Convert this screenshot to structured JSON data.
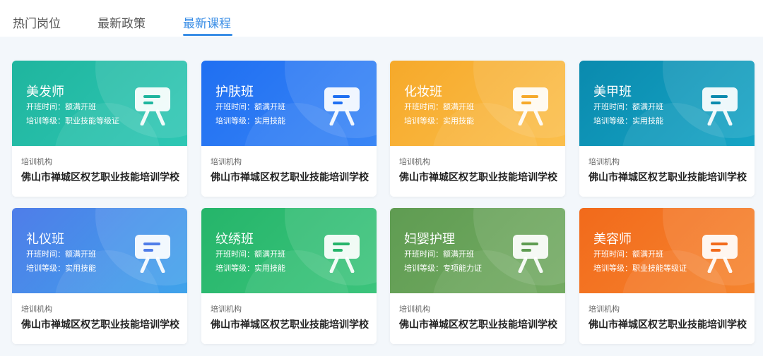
{
  "tabs": [
    {
      "label": "热门岗位",
      "active": false
    },
    {
      "label": "最新政策",
      "active": false
    },
    {
      "label": "最新课程",
      "active": true
    }
  ],
  "accent_color": "#3a8ee6",
  "courses": [
    {
      "title": "美发师",
      "start_label": "开班时间：",
      "start_value": "额满开班",
      "level_label": "培训等级：",
      "level_value": "职业技能等级证",
      "org_label": "培训机构",
      "org_name": "佛山市禅城区权艺职业技能培训学校",
      "gradient": [
        "#1fb59e",
        "#2ec7b4"
      ]
    },
    {
      "title": "护肤班",
      "start_label": "开班时间：",
      "start_value": "额满开班",
      "level_label": "培训等级：",
      "level_value": "实用技能",
      "org_label": "培训机构",
      "org_name": "佛山市禅城区权艺职业技能培训学校",
      "gradient": [
        "#1f6ff2",
        "#3a86f5"
      ]
    },
    {
      "title": "化妆班",
      "start_label": "开班时间：",
      "start_value": "额满开班",
      "level_label": "培训等级：",
      "level_value": "实用技能",
      "org_label": "培训机构",
      "org_name": "佛山市禅城区权艺职业技能培训学校",
      "gradient": [
        "#f6a92a",
        "#fbbf4c"
      ]
    },
    {
      "title": "美甲班",
      "start_label": "开班时间：",
      "start_value": "额满开班",
      "level_label": "培训等级：",
      "level_value": "实用技能",
      "org_label": "培训机构",
      "org_name": "佛山市禅城区权艺职业技能培训学校",
      "gradient": [
        "#0a8aae",
        "#16a5c5"
      ]
    },
    {
      "title": "礼仪班",
      "start_label": "开班时间：",
      "start_value": "额满开班",
      "level_label": "培训等级：",
      "level_value": "实用技能",
      "org_label": "培训机构",
      "org_name": "佛山市禅城区权艺职业技能培训学校",
      "gradient": [
        "#4f7de9",
        "#3fa3ea"
      ]
    },
    {
      "title": "纹绣班",
      "start_label": "开班时间：",
      "start_value": "额满开班",
      "level_label": "培训等级：",
      "level_value": "实用技能",
      "org_label": "培训机构",
      "org_name": "佛山市禅城区权艺职业技能培训学校",
      "gradient": [
        "#25b56a",
        "#3cc47c"
      ]
    },
    {
      "title": "妇婴护理",
      "start_label": "开班时间：",
      "start_value": "额满开班",
      "level_label": "培训等级：",
      "level_value": "专项能力证",
      "org_label": "培训机构",
      "org_name": "佛山市禅城区权艺职业技能培训学校",
      "gradient": [
        "#5f9c52",
        "#74ab63"
      ]
    },
    {
      "title": "美容师",
      "start_label": "开班时间：",
      "start_value": "额满开班",
      "level_label": "培训等级：",
      "level_value": "职业技能等级证",
      "org_label": "培训机构",
      "org_name": "佛山市禅城区权艺职业技能培训学校",
      "gradient": [
        "#f26a1b",
        "#f5852f"
      ]
    }
  ]
}
